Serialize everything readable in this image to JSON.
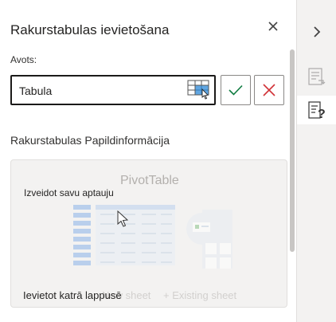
{
  "pane": {
    "title": "Rakurstabulas ievietošana",
    "close_icon": "close-icon",
    "source": {
      "label": "Avots:",
      "value": "Tabula",
      "range_picker_icon": "range-select-icon"
    },
    "ok_icon": "checkmark-icon",
    "cancel_icon": "cancel-x-icon",
    "section_title": "Rakurstabulas Papildinformācija",
    "card": {
      "overlay_text": "Izveidot savu aptauju",
      "faded_title": "PivotTable",
      "bottom_text": "Ievietot katrā lappusē",
      "faded_new_sheet": "New sheet",
      "faded_existing_sheet": "+ Existing sheet"
    }
  },
  "rail": {
    "collapse_icon": "chevron-right-icon",
    "items": [
      {
        "icon": "pivot-fields-icon",
        "active": false
      },
      {
        "icon": "pivot-help-icon",
        "active": true
      }
    ]
  },
  "colors": {
    "accent_green": "#107c41",
    "accent_red": "#d13438",
    "picker_blue": "#2b88d8"
  }
}
